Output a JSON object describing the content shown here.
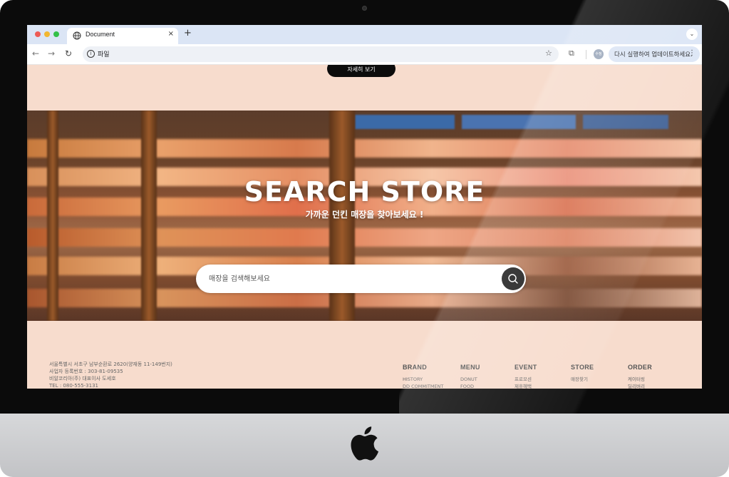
{
  "browser": {
    "tab_title": "Document",
    "tab_close": "×",
    "new_tab": "+",
    "url": "파일",
    "update_label": "다시 실행하여 업데이트하세요.",
    "profile_initials": "수정"
  },
  "page": {
    "more_button": "자세히 보기",
    "hero": {
      "title": "SEARCH STORE",
      "subtitle": "가까운 던킨 매장을 찾아보세요 !",
      "search_placeholder": "매장을 검색해보세요"
    },
    "footer": {
      "address_lines": [
        "서울특별시 서초구 남부순환로 2620(양재동 11-149번지)",
        "사업자 등록번호 : 303-81-09535",
        "비알코리아(주) 대표이사 도세호",
        "TEL : 080-555-3131"
      ],
      "columns": [
        {
          "heading": "BRAND",
          "links": [
            "HISTORY",
            "DD COMMITMENT"
          ]
        },
        {
          "heading": "MENU",
          "links": [
            "DONUT",
            "FOOD"
          ]
        },
        {
          "heading": "EVENT",
          "links": [
            "프로모션",
            "제휴혜택"
          ]
        },
        {
          "heading": "STORE",
          "links": [
            "매장찾기"
          ]
        },
        {
          "heading": "ORDER",
          "links": [
            "케이터링",
            "딜리버리"
          ]
        }
      ]
    }
  },
  "icons": {
    "tab": "globe-icon",
    "back": "arrow-left-icon",
    "forward": "arrow-right-icon",
    "reload": "reload-icon",
    "site_info": "info-icon",
    "bookmark": "star-icon",
    "extensions": "puzzle-icon",
    "menu": "kebab-icon",
    "search": "search-icon",
    "device_logo": "apple-logo-icon"
  },
  "colors": {
    "page_background": "#f7dccd",
    "search_button": "#1d1d1d",
    "more_button": "#0c0c0c"
  }
}
